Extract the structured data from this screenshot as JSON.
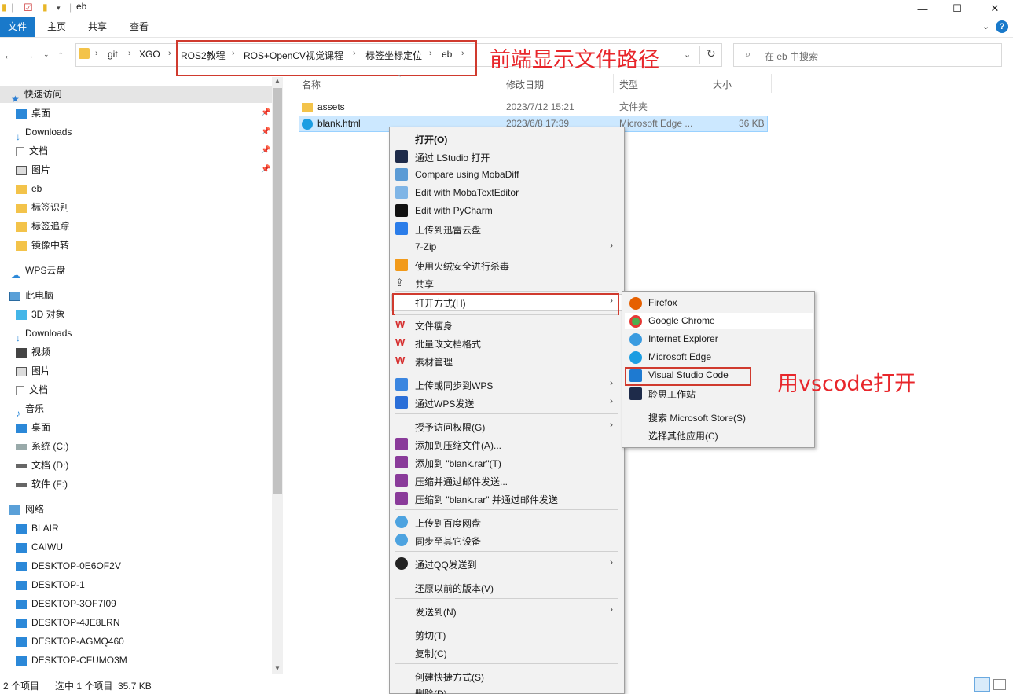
{
  "window": {
    "title": "eb"
  },
  "ribbon": {
    "tabs": [
      "文件",
      "主页",
      "共享",
      "查看"
    ]
  },
  "address": {
    "crumbs": [
      "git",
      "XGO",
      "ROS2教程",
      "ROS+OpenCV视觉课程",
      "标签坐标定位",
      "eb"
    ]
  },
  "search": {
    "placeholder": "在 eb 中搜索"
  },
  "nav": {
    "quick_access": "快速访问",
    "quick_items": [
      "桌面",
      "Downloads",
      "文档",
      "图片",
      "eb",
      "标签识别",
      "标签追踪",
      "镜像中转"
    ],
    "wps": "WPS云盘",
    "this_pc": "此电脑",
    "pc_items": [
      "3D 对象",
      "Downloads",
      "视频",
      "图片",
      "文档",
      "音乐",
      "桌面",
      "系统 (C:)",
      "文档 (D:)",
      "软件 (F:)"
    ],
    "network": "网络",
    "network_items": [
      "BLAIR",
      "CAIWU",
      "DESKTOP-0E6OF2V",
      "DESKTOP-1",
      "DESKTOP-3OF7I09",
      "DESKTOP-4JE8LRN",
      "DESKTOP-AGMQ460",
      "DESKTOP-CFUMO3M"
    ]
  },
  "columns": {
    "name": "名称",
    "date": "修改日期",
    "type": "类型",
    "size": "大小"
  },
  "files": [
    {
      "name": "assets",
      "date": "2023/7/12 15:21",
      "type": "文件夹",
      "size": ""
    },
    {
      "name": "blank.html",
      "date": "2023/6/8 17:39",
      "type": "Microsoft Edge ...",
      "size": "36 KB"
    }
  ],
  "context_menu": {
    "items": [
      "打开(O)",
      "通过 LStudio 打开",
      "Compare using MobaDiff",
      "Edit with MobaTextEditor",
      "Edit with PyCharm",
      "上传到迅雷云盘",
      "7-Zip",
      "使用火绒安全进行杀毒",
      "共享",
      "打开方式(H)",
      "文件瘦身",
      "批量改文档格式",
      "素材管理",
      "上传或同步到WPS",
      "通过WPS发送",
      "授予访问权限(G)",
      "添加到压缩文件(A)...",
      "添加到 \"blank.rar\"(T)",
      "压缩并通过邮件发送...",
      "压缩到 \"blank.rar\" 并通过邮件发送",
      "上传到百度网盘",
      "同步至其它设备",
      "通过QQ发送到",
      "还原以前的版本(V)",
      "发送到(N)",
      "剪切(T)",
      "复制(C)",
      "创建快捷方式(S)",
      "删除(D)"
    ]
  },
  "open_with": {
    "items": [
      "Firefox",
      "Google Chrome",
      "Internet Explorer",
      "Microsoft Edge",
      "Visual Studio Code",
      "聆思工作站",
      "搜索 Microsoft Store(S)",
      "选择其他应用(C)"
    ]
  },
  "annotations": {
    "path_note": "前端显示文件路径",
    "vscode_note": "用vscode打开"
  },
  "status": {
    "count": "2 个项目",
    "selected": "选中 1 个项目  35.7 KB"
  },
  "colors": {
    "accent": "#1979ca",
    "selection": "#cce8ff",
    "annotation_red": "#e8262b"
  }
}
